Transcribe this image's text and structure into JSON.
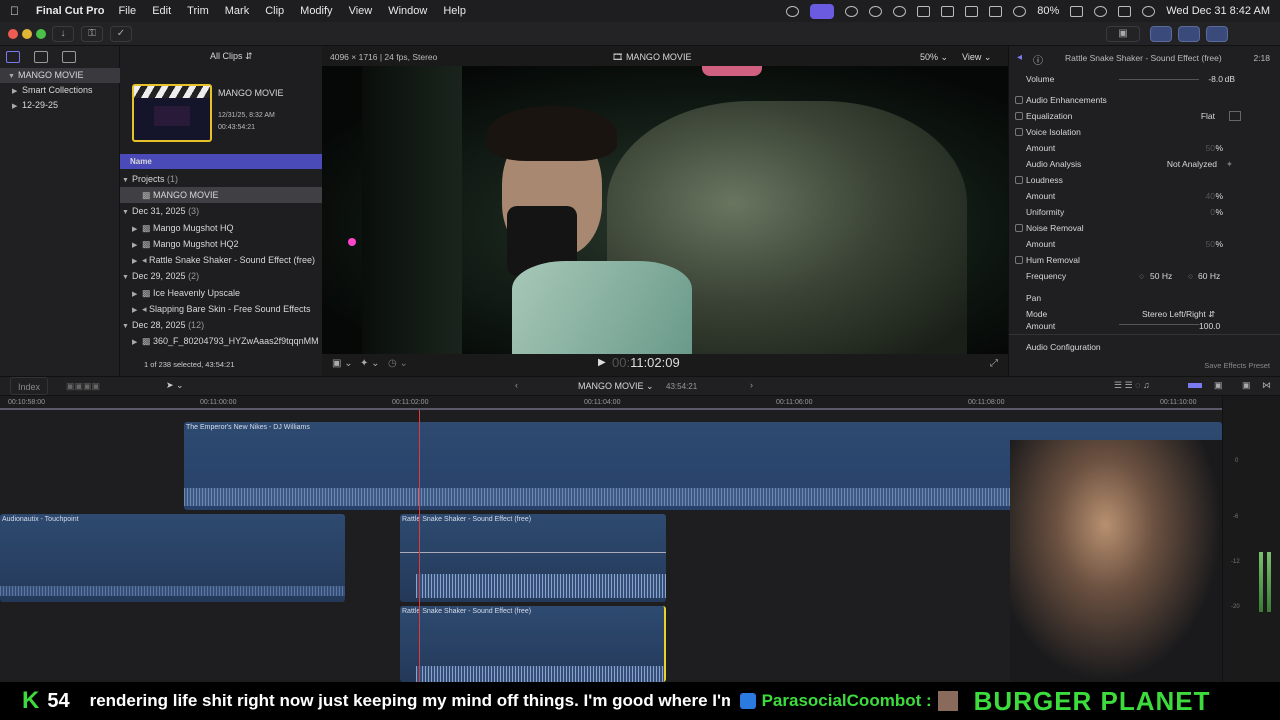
{
  "menubar": {
    "app": "Final Cut Pro",
    "items": [
      "File",
      "Edit",
      "Trim",
      "Mark",
      "Clip",
      "Modify",
      "View",
      "Window",
      "Help"
    ],
    "battery": "80%",
    "clock": "Wed Dec 31  8:42 AM"
  },
  "library": {
    "rows": [
      "MANGO MOVIE",
      "Smart Collections",
      "12-29-25"
    ]
  },
  "browser": {
    "filter": "All Clips",
    "project_title": "MANGO MOVIE",
    "project_date": "12/31/25, 8:32 AM",
    "project_duration": "00:43:54:21",
    "column_name": "Name",
    "rows": [
      {
        "label": "Projects",
        "count": "(1)",
        "type": "group"
      },
      {
        "label": "MANGO MOVIE",
        "count": "",
        "type": "project"
      },
      {
        "label": "Dec 31, 2025",
        "count": "(3)",
        "type": "group"
      },
      {
        "label": "Mango Mugshot HQ",
        "count": "",
        "type": "item"
      },
      {
        "label": "Mango Mugshot HQ2",
        "count": "",
        "type": "item"
      },
      {
        "label": "Rattle Snake Shaker - Sound Effect (free)",
        "count": "",
        "type": "item"
      },
      {
        "label": "Dec 29, 2025",
        "count": "(2)",
        "type": "group"
      },
      {
        "label": "Ice Heavenly Upscale",
        "count": "",
        "type": "item"
      },
      {
        "label": "Slapping Bare Skin - Free Sound Effects",
        "count": "",
        "type": "item"
      },
      {
        "label": "Dec 28, 2025",
        "count": "(12)",
        "type": "group"
      },
      {
        "label": "360_F_80204793_HYZwAaas2f9tqqnMM",
        "count": "",
        "type": "item"
      }
    ],
    "status": "1 of 238 selected, 43:54:21"
  },
  "viewer": {
    "format": "4096 × 1716 | 24 fps, Stereo",
    "title": "MANGO MOVIE",
    "zoom": "50%",
    "view": "View",
    "timecode": "11:02:09"
  },
  "inspector": {
    "clip_title": "Rattle Snake Shaker - Sound Effect (free)",
    "duration": "2:18",
    "volume_label": "Volume",
    "volume_value": "-8.0",
    "volume_unit": "dB",
    "section": "Audio Enhancements",
    "rows": [
      {
        "label": "Equalization",
        "value": "Flat",
        "check": true
      },
      {
        "label": "Voice Isolation",
        "value": "",
        "check": true
      },
      {
        "label": "Amount",
        "value": "50",
        "unit": "%",
        "check": false
      },
      {
        "label": "Audio Analysis",
        "value": "Not Analyzed",
        "check": false
      },
      {
        "label": "Loudness",
        "value": "",
        "check": true
      },
      {
        "label": "Amount",
        "value": "40",
        "unit": "%",
        "check": false
      },
      {
        "label": "Uniformity",
        "value": "0",
        "unit": "%",
        "check": false
      },
      {
        "label": "Noise Removal",
        "value": "",
        "check": true
      },
      {
        "label": "Amount",
        "value": "50",
        "unit": "%",
        "check": false
      },
      {
        "label": "Hum Removal",
        "value": "",
        "check": true
      }
    ],
    "frequency_label": "Frequency",
    "freq_50": "50 Hz",
    "freq_60": "60 Hz",
    "pan_label": "Pan",
    "mode_label": "Mode",
    "mode_value": "Stereo Left/Right",
    "amount_label": "Amount",
    "amount_value": "100.0",
    "audio_config": "Audio Configuration",
    "save_preset": "Save Effects Preset"
  },
  "timeline": {
    "index": "Index",
    "project": "MANGO MOVIE",
    "duration": "43:54:21",
    "ruler": [
      "00:10:58:00",
      "00:11:00:00",
      "00:11:02:00",
      "00:11:04:00",
      "00:11:06:00",
      "00:11:08:00",
      "00:11:10:00"
    ],
    "clips": {
      "music": "The Emperor's New Nikes - DJ Williams",
      "audionautix": "Audionautix - Touchpoint",
      "rattle1": "Rattle Snake Shaker - Sound Effect (free)",
      "rattle2": "Rattle Snake Shaker - Sound Effect (free)"
    },
    "meter_labels": [
      "0",
      "-6",
      "-12",
      "-20"
    ]
  },
  "chat": {
    "k_label": "K",
    "count": "54",
    "message": "rendering life shit right now just keeping my mind off things. I'm good where I'm at rn",
    "user": "ParasocialCoombot :",
    "brand": "BURGER PLANET"
  },
  "colors": {
    "accent": "#6a5be0",
    "clip_audio": "#2d4a72",
    "clip_audio_dark": "#24395a",
    "playhead": "#e03a3a",
    "chat_green": "#3ddc3d"
  }
}
